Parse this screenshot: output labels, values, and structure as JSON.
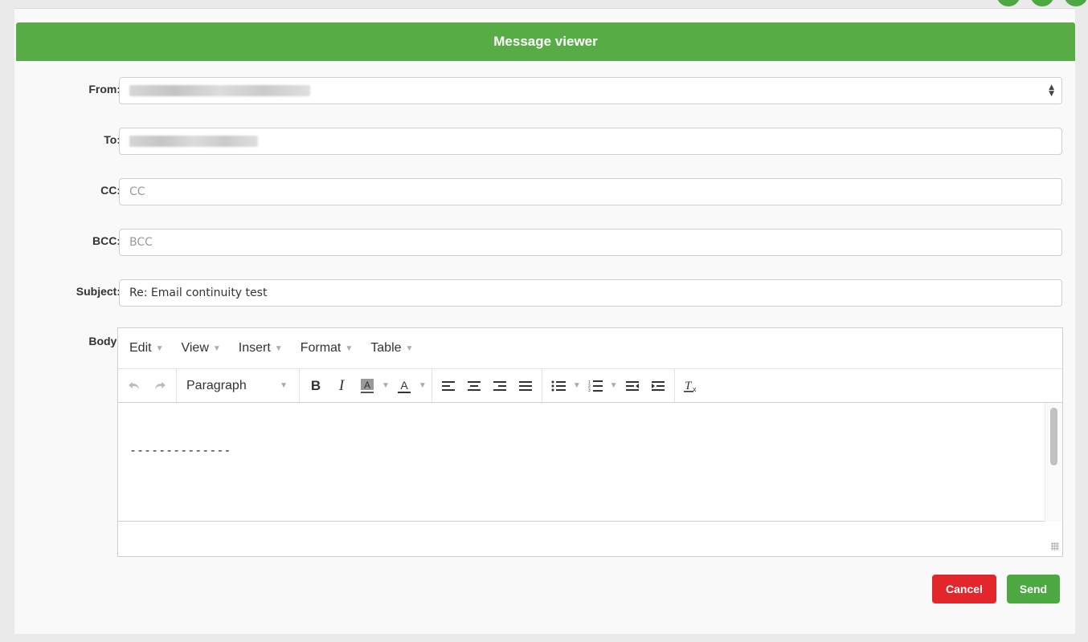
{
  "window": {
    "title": "Message viewer"
  },
  "form": {
    "from_label": "From:",
    "to_label": "To:",
    "cc_label": "CC:",
    "bcc_label": "BCC:",
    "subject_label": "Subject:",
    "body_label": "Body:",
    "cc_placeholder": "CC",
    "bcc_placeholder": "BCC",
    "subject_value": "Re: Email continuity test"
  },
  "editor": {
    "menus": [
      "Edit",
      "View",
      "Insert",
      "Format",
      "Table"
    ],
    "block_format": "Paragraph",
    "body_text": "--------------",
    "icons": [
      "undo-icon",
      "redo-icon",
      "bold-icon",
      "italic-icon",
      "background-color-icon",
      "text-color-icon",
      "align-left-icon",
      "align-center-icon",
      "align-right-icon",
      "align-justify-icon",
      "bullet-list-icon",
      "numbered-list-icon",
      "outdent-icon",
      "indent-icon",
      "clear-formatting-icon"
    ]
  },
  "actions": {
    "cancel_label": "Cancel",
    "send_label": "Send"
  },
  "colors": {
    "header": "#58ac45",
    "cancel": "#e2262c",
    "send": "#4ea842"
  }
}
